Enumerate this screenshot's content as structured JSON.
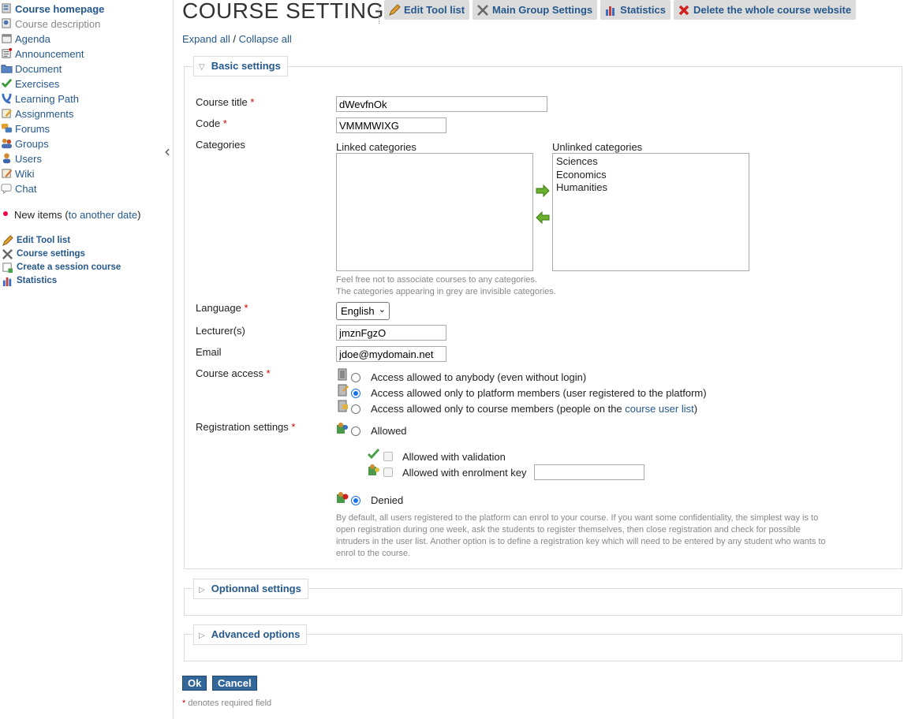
{
  "sidebar": {
    "tools": [
      {
        "label": "Course homepage",
        "icon": "home-icon"
      },
      {
        "label": "Course description",
        "icon": "description-icon"
      },
      {
        "label": "Agenda",
        "icon": "agenda-icon"
      },
      {
        "label": "Announcement",
        "icon": "announcement-icon"
      },
      {
        "label": "Document",
        "icon": "folder-icon"
      },
      {
        "label": "Exercises",
        "icon": "check-icon"
      },
      {
        "label": "Learning Path",
        "icon": "learning-path-icon"
      },
      {
        "label": "Assignments",
        "icon": "assignment-icon"
      },
      {
        "label": "Forums",
        "icon": "forum-icon"
      },
      {
        "label": "Groups",
        "icon": "groups-icon"
      },
      {
        "label": "Users",
        "icon": "user-icon"
      },
      {
        "label": "Wiki",
        "icon": "wiki-icon"
      },
      {
        "label": "Chat",
        "icon": "chat-icon"
      }
    ],
    "new_items": {
      "label": "New items",
      "open": "(",
      "link": "to another date",
      "close": ")"
    },
    "admin": [
      {
        "label": "Edit Tool list",
        "icon": "pencil-icon"
      },
      {
        "label": "Course settings",
        "icon": "tools-icon"
      },
      {
        "label": "Create a session course",
        "icon": "session-icon"
      },
      {
        "label": "Statistics",
        "icon": "chart-icon"
      }
    ]
  },
  "header": {
    "title": "COURSE SETTINGS",
    "buttons": [
      {
        "label": "Edit Tool list",
        "icon": "pencil-icon"
      },
      {
        "label": "Main Group Settings",
        "icon": "tools-icon"
      },
      {
        "label": "Statistics",
        "icon": "chart-icon"
      },
      {
        "label": "Delete the whole course website",
        "icon": "delete-icon"
      }
    ],
    "expand_all": "Expand all",
    "separator": "/",
    "collapse_all": "Collapse all"
  },
  "basic": {
    "legend": "Basic settings",
    "course_title_label": "Course title",
    "course_title_value": "dWevfnOk",
    "code_label": "Code",
    "code_value": "VMMMWIXG",
    "categories_label": "Categories",
    "linked_label": "Linked categories",
    "unlinked_label": "Unlinked categories",
    "unlinked_items": [
      "Sciences",
      "Economics",
      "Humanities"
    ],
    "categories_help_1": "Feel free not to associate courses to any categories.",
    "categories_help_2": "The categories appearing in grey are invisible categories.",
    "language_label": "Language",
    "language_value": "English",
    "lecturers_label": "Lecturer(s)",
    "lecturers_value": "jmznFgzO",
    "email_label": "Email",
    "email_value": "jdoe@mydomain.net",
    "access_label": "Course access",
    "access_opt_1": "Access allowed to anybody (even without login)",
    "access_opt_2": "Access allowed only to platform members (user registered to the platform)",
    "access_opt_3_pre": "Access allowed only to course members (people on the ",
    "access_opt_3_link": "course user list",
    "access_opt_3_post": ")",
    "registration_label": "Registration settings",
    "reg_allowed": "Allowed",
    "reg_validation": "Allowed with validation",
    "reg_key": "Allowed with enrolment key",
    "reg_denied": "Denied",
    "reg_help": "By default, all users registered to the platform can enrol to your course. If you want some confidentiality, the simplest way is to open registration during one week, ask the students to register themselves, then close registration and check for possible intruders in the user list. Another option is to define a registration key which will need to be entered by any student who wants to enrol to the course.",
    "required_mark": "*"
  },
  "optional": {
    "legend": "Optionnal settings"
  },
  "advanced": {
    "legend": "Advanced options"
  },
  "actions": {
    "ok": "Ok",
    "cancel": "Cancel"
  },
  "footnote": {
    "mark": "*",
    "text": " denotes required field"
  },
  "colors": {
    "link": "#25588c",
    "required": "#cc0000",
    "button": "#336699"
  }
}
